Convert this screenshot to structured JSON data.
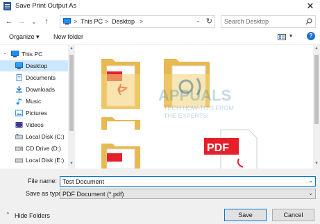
{
  "window": {
    "title": "Save Print Output As",
    "close_glyph": "✕"
  },
  "nav": {
    "back_glyph": "←",
    "forward_glyph": "→",
    "recent_glyph": "⌄",
    "up_glyph": "↑",
    "breadcrumb": [
      "This PC",
      "Desktop"
    ],
    "separator": ">",
    "refresh_glyph": "↻",
    "dropdown_glyph": "⌄",
    "search_placeholder": "Search Desktop"
  },
  "toolbar": {
    "organize_label": "Organize ▾",
    "new_folder_label": "New folder",
    "view_dropdown": "▾",
    "help_glyph": "?"
  },
  "sidebar": {
    "items": [
      {
        "label": "This PC",
        "icon": "computer-icon",
        "color": "#1e90ff"
      },
      {
        "label": "Desktop",
        "icon": "desktop-icon",
        "color": "#1e90ff"
      },
      {
        "label": "Documents",
        "icon": "documents-icon",
        "color": "#5a8fd8"
      },
      {
        "label": "Downloads",
        "icon": "downloads-icon",
        "color": "#1e73d8"
      },
      {
        "label": "Music",
        "icon": "music-icon",
        "color": "#2a8ad8"
      },
      {
        "label": "Pictures",
        "icon": "pictures-icon",
        "color": "#3a9ad8"
      },
      {
        "label": "Videos",
        "icon": "videos-icon",
        "color": "#3a3a8a"
      },
      {
        "label": "Local Disk (C:)",
        "icon": "drive-icon",
        "color": "#8a8a8a"
      },
      {
        "label": "CD Drive (D:)",
        "icon": "cd-drive-icon",
        "color": "#8a8a8a"
      },
      {
        "label": "Local Disk (E:)",
        "icon": "drive-icon",
        "color": "#8a8a8a"
      }
    ],
    "selected_index": 1
  },
  "content": {
    "watermark": {
      "brand": "APPUALS",
      "tagline_line1": "TECH HOW-TO'S FROM",
      "tagline_line2": "THE EXPERTS!"
    },
    "pdf_label": "PDF"
  },
  "form": {
    "file_name_label": "File name:",
    "file_name_value": "Test Document",
    "save_as_type_label": "Save as type:",
    "save_as_type_value": "PDF Document (*.pdf)",
    "dropdown_glyph": "⌄"
  },
  "footer": {
    "hide_folders_label": "Hide Folders",
    "hide_folders_chevron": "⌃",
    "save_label": "Save",
    "cancel_label": "Cancel"
  },
  "colors": {
    "selection": "#cce8ff",
    "accent": "#0078d7",
    "pdf_red": "#e6202a",
    "folder_yellow": "#f4d27a"
  }
}
